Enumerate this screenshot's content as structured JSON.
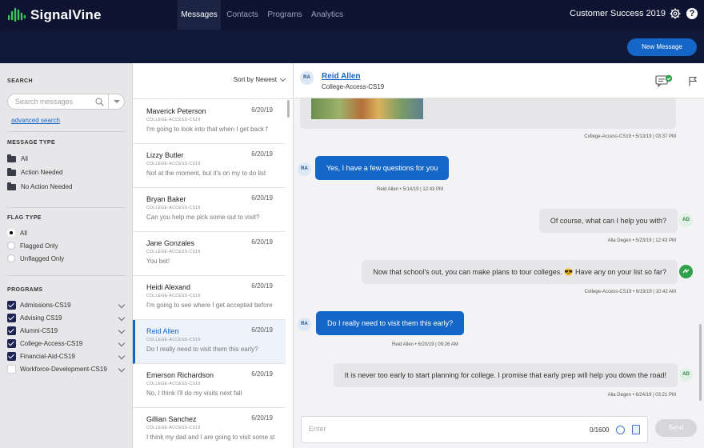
{
  "brand": {
    "name": "SignalVine",
    "accent": "#1466c8",
    "nav_bg": "#0d1330"
  },
  "nav": {
    "tabs": [
      "Messages",
      "Contacts",
      "Programs",
      "Analytics"
    ],
    "active_tab": "Messages",
    "org": "Customer Success 2019",
    "gear_icon": "gear-icon",
    "help_label": "?"
  },
  "actions": {
    "new_message": "New Message"
  },
  "sidebar": {
    "search_title": "SEARCH",
    "search_placeholder": "Search messages",
    "advanced_search": "advanced search",
    "message_type_title": "MESSAGE TYPE",
    "message_types": [
      "All",
      "Action Needed",
      "No Action Needed"
    ],
    "flag_type_title": "FLAG TYPE",
    "flag_types": [
      "All",
      "Flagged Only",
      "Unflagged Only"
    ],
    "selected_flag_type": "All",
    "programs_title": "PROGRAMS",
    "programs": [
      {
        "label": "Admissions-CS19",
        "checked": true
      },
      {
        "label": "Advising CS19",
        "checked": true
      },
      {
        "label": "Alumni-CS19",
        "checked": true
      },
      {
        "label": "College-Access-CS19",
        "checked": true
      },
      {
        "label": "Financial-Aid-CS19",
        "checked": true
      },
      {
        "label": "Workforce-Development-CS19",
        "checked": false
      }
    ]
  },
  "list": {
    "sort_label": "Sort by Newest",
    "conversations": [
      {
        "name": "Maverick Peterson",
        "date": "6/20/19",
        "program": "COLLEGE-ACCESS-CS19",
        "snippet": "I'm going to look into that when I get back f"
      },
      {
        "name": "Lizzy Butler",
        "date": "6/20/19",
        "program": "COLLEGE-ACCESS-CS19",
        "snippet": "Not at the moment, but it's on my to do list"
      },
      {
        "name": "Bryan Baker",
        "date": "6/20/19",
        "program": "COLLEGE-ACCESS-CS19",
        "snippet": "Can you help me pick some out to visit?"
      },
      {
        "name": "Jane Gonzales",
        "date": "6/20/19",
        "program": "COLLEGE-ACCESS-CS19",
        "snippet": "You bet!"
      },
      {
        "name": "Heidi Alexand",
        "date": "6/20/19",
        "program": "COLLEGE-ACCESS-CS19",
        "snippet": "I'm going to see where I get accepted before"
      },
      {
        "name": "Reid Allen",
        "date": "6/20/19",
        "program": "COLLEGE-ACCESS-CS19",
        "snippet": "Do I really need to visit them this early?"
      },
      {
        "name": "Emerson Richardson",
        "date": "6/20/19",
        "program": "COLLEGE-ACCESS-CS19",
        "snippet": "No, I think I'll do my visits next fall"
      },
      {
        "name": "Gillian Sanchez",
        "date": "6/20/19",
        "program": "COLLEGE-ACCESS-CS19",
        "snippet": "I think my dad and I are going to visit some st"
      }
    ]
  },
  "chat": {
    "contact_initials": "RA",
    "contact_name": "Reid Allen",
    "contact_program": "College-Access-CS19",
    "staff_initials": "AD",
    "messages": [
      {
        "meta": "College-Access-CS19 • 5/13/19 | 03:37 PM"
      },
      {
        "text": "Yes, I have a few questions for you",
        "meta": "Reid Allen • 5/14/19 | 12:43 PM"
      },
      {
        "text": "Of course, what can I help you with?",
        "meta": "Alia Degen • 5/23/19 | 12:43 PM"
      },
      {
        "text": "Now that school's out, you can make plans to tour colleges. 😎 Have any on your list so far?",
        "meta": "College-Access-CS19 • 6/19/19 | 10:42 AM"
      },
      {
        "text": "Do I really need to visit them this early?",
        "meta": "Reid Allen • 6/20/19 | 09:26 AM"
      },
      {
        "text": "It is never too early to start planning for college. I promise that early prep will help you down the road!",
        "meta": "Alia Degen • 6/24/19 | 03:21 PM"
      }
    ],
    "composer_placeholder": "Enter",
    "counter": "0/1600",
    "send": "Send"
  }
}
